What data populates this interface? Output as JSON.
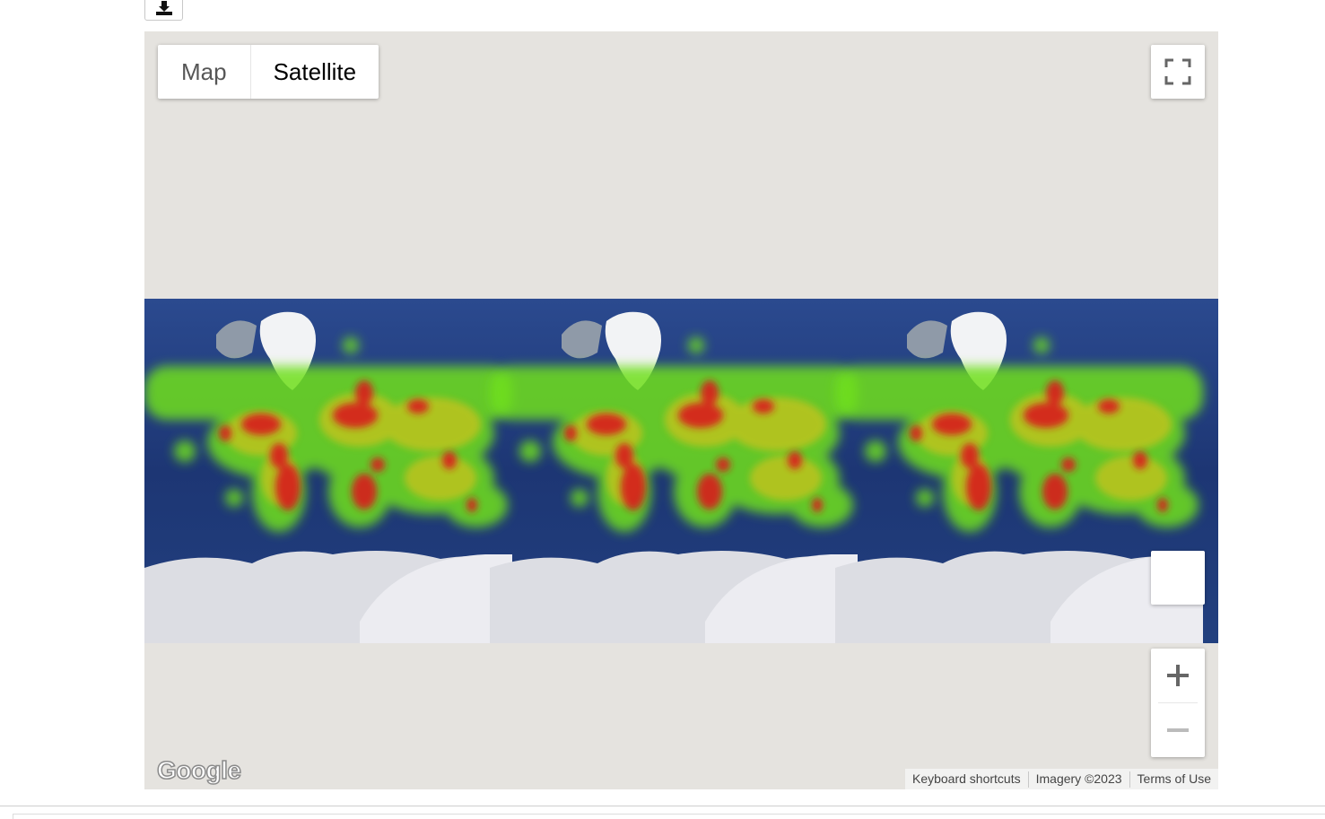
{
  "toolbar": {
    "download_icon": "download-icon"
  },
  "map": {
    "map_type_options": [
      "Map",
      "Satellite"
    ],
    "selected_map_type": "Satellite",
    "fullscreen_icon": "fullscreen-icon",
    "pegman_icon": "street-view-pegman-icon",
    "zoom_in_icon": "plus-icon",
    "zoom_out_icon": "minus-icon",
    "logo_text": "Google",
    "attribution": {
      "shortcuts": "Keyboard shortcuts",
      "imagery": "Imagery ©2023",
      "terms": "Terms of Use"
    },
    "layer": "heatmap",
    "colors": {
      "ocean": "#1f3a7a",
      "ice": "#dcdde3",
      "heat_low": "#6fe01c",
      "heat_mid": "#c9c21a",
      "heat_high": "#d81e1e",
      "background": "#e5e3df"
    }
  }
}
